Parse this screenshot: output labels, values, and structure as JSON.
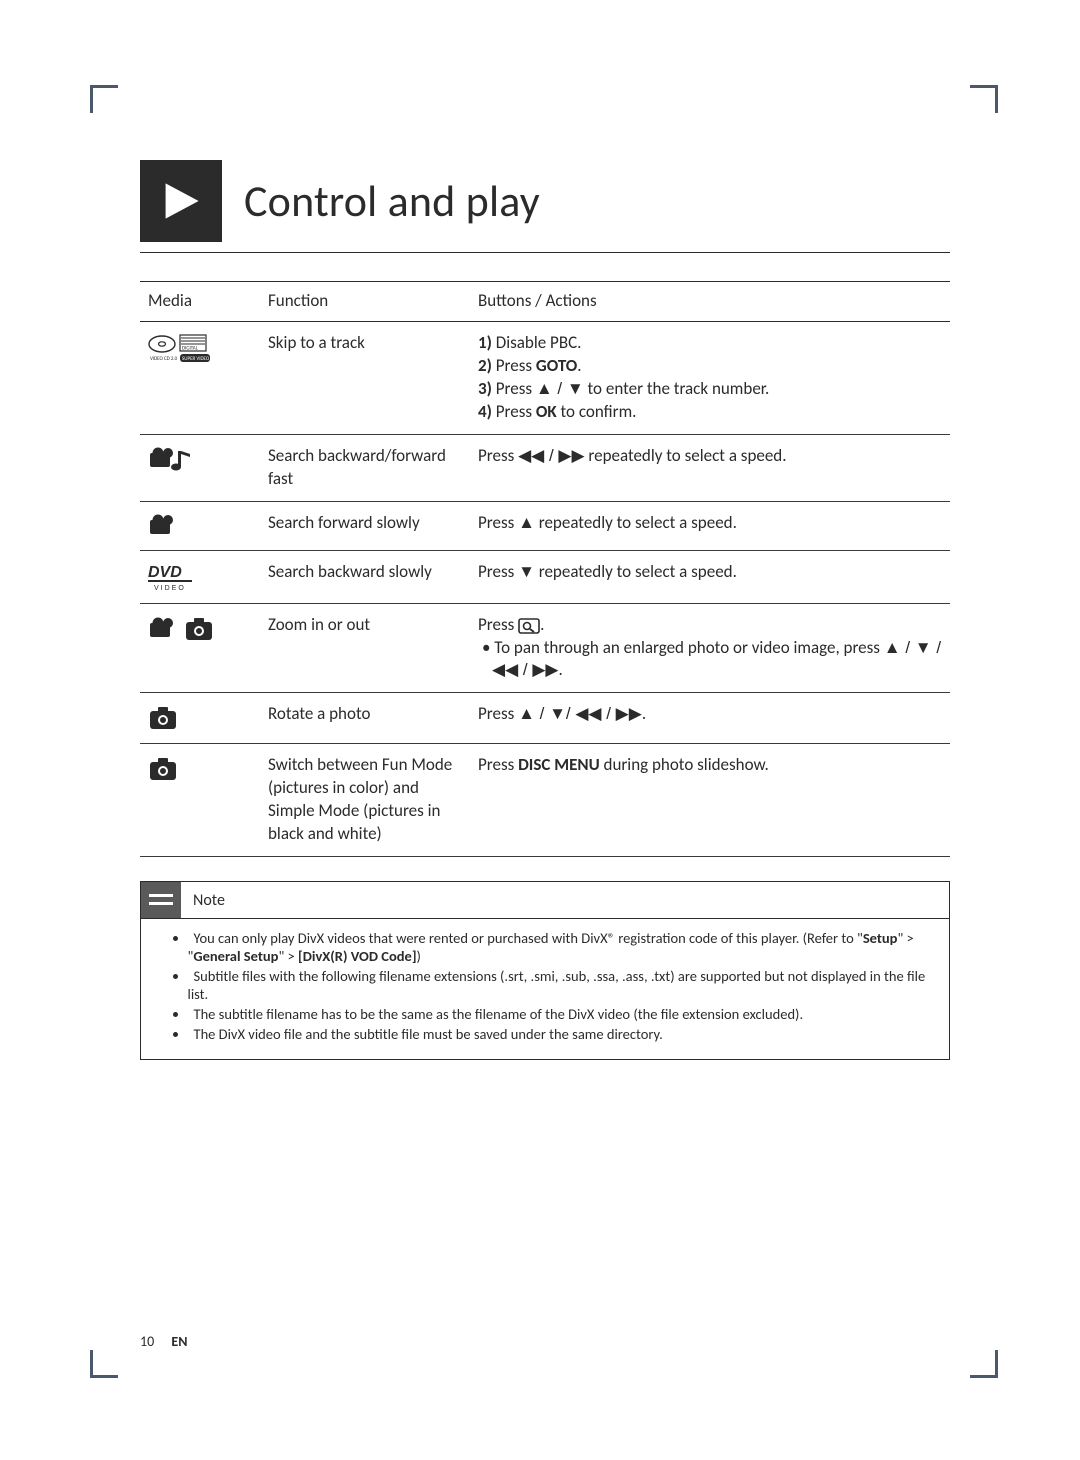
{
  "title": "Control and play",
  "table": {
    "headers": {
      "media": "Media",
      "function": "Function",
      "actions": "Buttons / Actions"
    },
    "rows": [
      {
        "icon": "vcd",
        "function": "Skip to a track",
        "action_template": "skip_track",
        "a1_num": "1)",
        "a1_txt": " Disable PBC.",
        "a2_num": "2)",
        "a2_pre": " Press ",
        "a2_btn": "GOTO",
        "a2_post": ".",
        "a3_num": "3)",
        "a3_pre": " Press ",
        "a3_arr": "▲ / ▼",
        "a3_post": " to enter the track number.",
        "a4_num": "4)",
        "a4_pre": " Press ",
        "a4_btn": "OK",
        "a4_post": " to confirm."
      },
      {
        "icon": "video_music",
        "function": "Search backward/forward fast",
        "action_template": "press_arrows",
        "pre": "Press ",
        "arr": "◀◀ / ▶▶",
        "post": " repeatedly to select a speed."
      },
      {
        "icon": "video",
        "function": "Search forward slowly",
        "action_template": "press_arrows",
        "pre": "Press ",
        "arr": "▲",
        "post": " repeatedly to select a speed."
      },
      {
        "icon": "dvd",
        "function": "Search backward slowly",
        "action_template": "press_arrows",
        "pre": "Press ",
        "arr": "▼",
        "post": " repeatedly to select a speed."
      },
      {
        "icon": "video_photo",
        "function": "Zoom in or out",
        "action_template": "zoom",
        "l1_pre": "Press ",
        "l1_post": ".",
        "l2_bullet": "•",
        "l2_pre": " To pan through an enlarged photo or video image, press ",
        "l2_arr": "▲ / ▼ / ◀◀ / ▶▶",
        "l2_post": "."
      },
      {
        "icon": "photo",
        "function": "Rotate a photo",
        "action_template": "press_arrows",
        "pre": "Press ",
        "arr": "▲ / ▼/ ◀◀ / ▶▶",
        "post": "."
      },
      {
        "icon": "photo",
        "function": "Switch between Fun Mode (pictures in color) and Simple Mode (pictures in black and white)",
        "action_template": "press_btn",
        "pre": "Press ",
        "btn": "DISC MENU",
        "post": " during photo slideshow."
      }
    ]
  },
  "note": {
    "title": "Note",
    "items": [
      {
        "template": "n1",
        "p1": "You can only play DivX videos that were rented or purchased with DivX® registration code of this player. (Refer to \"",
        "b1": "Setup",
        "p2": "\" > \"",
        "b2": "General Setup",
        "p3": "\" > ",
        "b3": "[DivX(R) VOD Code]",
        "p4": ")"
      },
      {
        "template": "plain",
        "text": "Subtitle files with the following filename extensions (.srt, .smi, .sub, .ssa, .ass, .txt) are supported but not displayed in the file list."
      },
      {
        "template": "plain",
        "text": "The subtitle filename has to be the same as the filename of the DivX video (the file extension excluded)."
      },
      {
        "template": "plain",
        "text": "The DivX video file and the subtitle file must be saved under the same directory."
      }
    ]
  },
  "footer": {
    "page": "10",
    "lang": "EN"
  }
}
